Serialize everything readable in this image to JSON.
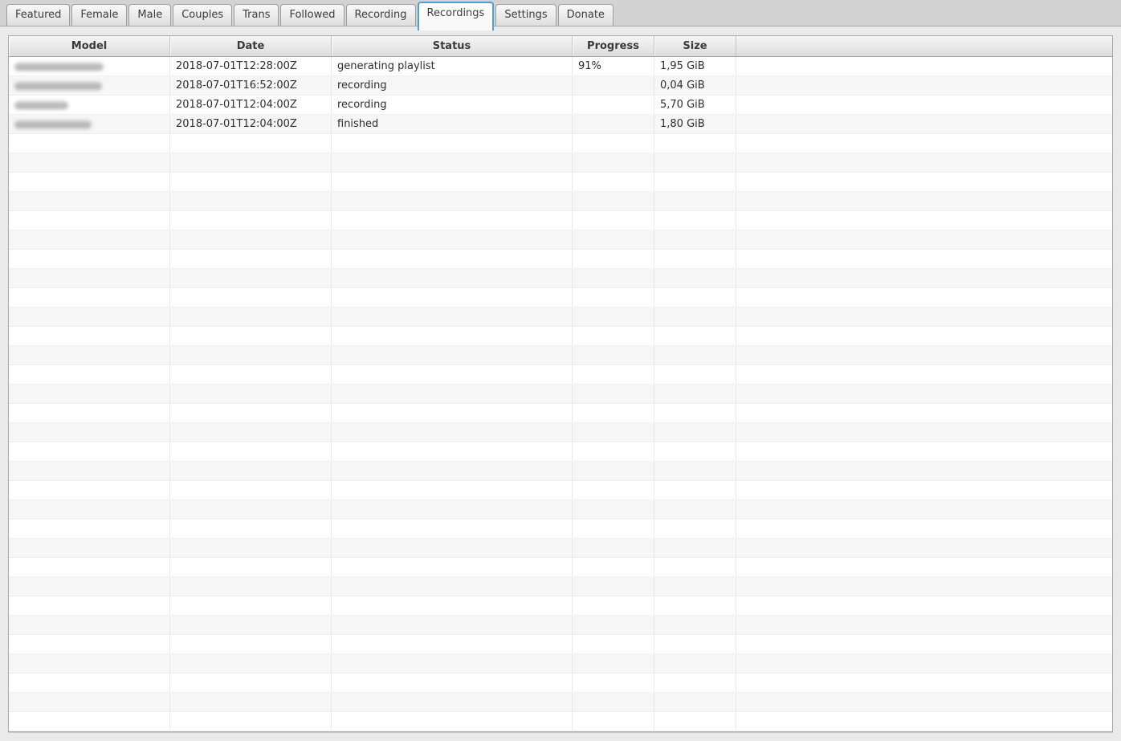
{
  "window": {
    "background": "#eaeaea",
    "tab_strip_background": "#d3d3d3",
    "active_tab_border_color": "#4da1d6",
    "row_stripe_color": "#f6f6f6"
  },
  "tabs": [
    {
      "label": "Featured",
      "active": false
    },
    {
      "label": "Female",
      "active": false
    },
    {
      "label": "Male",
      "active": false
    },
    {
      "label": "Couples",
      "active": false
    },
    {
      "label": "Trans",
      "active": false
    },
    {
      "label": "Followed",
      "active": false
    },
    {
      "label": "Recording",
      "active": false
    },
    {
      "label": "Recordings",
      "active": true
    },
    {
      "label": "Settings",
      "active": false
    },
    {
      "label": "Donate",
      "active": false
    }
  ],
  "table": {
    "columns": [
      {
        "label": "Model"
      },
      {
        "label": "Date"
      },
      {
        "label": "Status"
      },
      {
        "label": "Progress"
      },
      {
        "label": "Size"
      }
    ],
    "rows": [
      {
        "model_blurred": true,
        "model_blur_width": 111,
        "date": "2018-07-01T12:28:00Z",
        "status": "generating playlist",
        "progress": "91%",
        "size": "1,95 GiB"
      },
      {
        "model_blurred": true,
        "model_blur_width": 109,
        "date": "2018-07-01T16:52:00Z",
        "status": "recording",
        "progress": "",
        "size": "0,04 GiB"
      },
      {
        "model_blurred": true,
        "model_blur_width": 67,
        "date": "2018-07-01T12:04:00Z",
        "status": "recording",
        "progress": "",
        "size": "5,70 GiB"
      },
      {
        "model_blurred": true,
        "model_blur_width": 96,
        "date": "2018-07-01T12:04:00Z",
        "status": "finished",
        "progress": "",
        "size": "1,80 GiB"
      }
    ],
    "empty_row_count": 31
  }
}
